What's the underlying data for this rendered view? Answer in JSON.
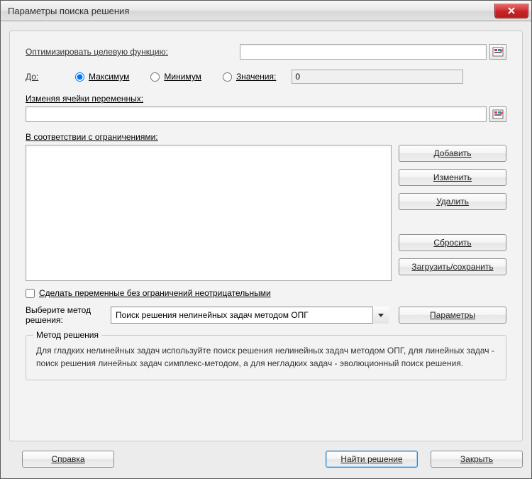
{
  "window": {
    "title": "Параметры поиска решения"
  },
  "labels": {
    "objective": "Оптимизировать целевую функцию:",
    "to": "До:",
    "variables": "Изменяя ячейки переменных:",
    "constraints": "В соответствии с ограничениями:",
    "unconstrained_nonneg": "Сделать переменные без ограничений неотрицательными",
    "method_label": "Выберите метод решения:",
    "groupbox_title": "Метод решения",
    "method_description": "Для гладких нелинейных задач используйте поиск решения нелинейных задач методом ОПГ, для линейных задач - поиск решения линейных задач симплекс-методом, а для негладких задач - эволюционный поиск решения."
  },
  "radios": {
    "max": "Максимум",
    "min": "Минимум",
    "value": "Значения:",
    "selected": "max",
    "value_input": "0"
  },
  "inputs": {
    "objective": "",
    "variables": ""
  },
  "select": {
    "value": "Поиск решения нелинейных задач методом ОПГ"
  },
  "buttons": {
    "add": "Добавить",
    "change": "Изменить",
    "delete": "Удалить",
    "reset": "Сбросить",
    "load_save": "Загрузить/сохранить",
    "params": "Параметры",
    "help": "Справка",
    "solve": "Найти решение",
    "close": "Закрыть"
  },
  "checkbox": {
    "unconstrained_checked": false
  }
}
